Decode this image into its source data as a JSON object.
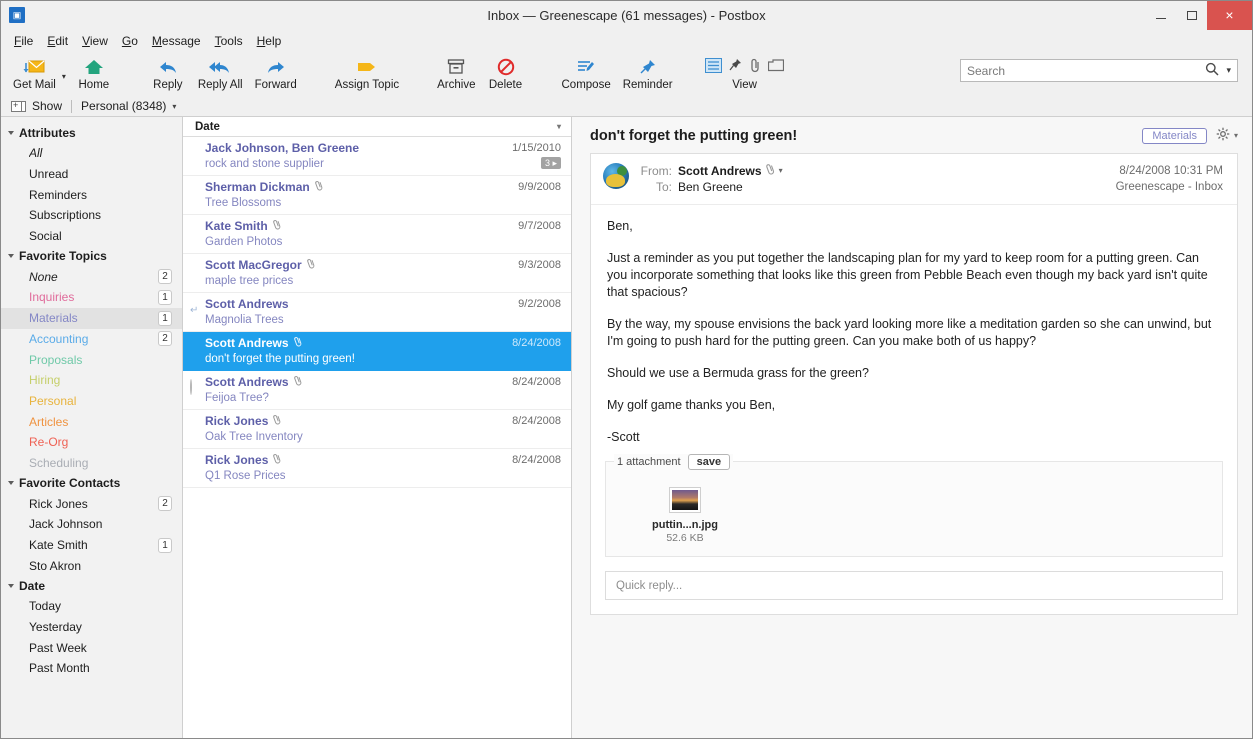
{
  "window": {
    "title": "Inbox — Greenescape (61 messages) - Postbox",
    "app_icon": "postbox-icon",
    "minimize": "–",
    "maximize": "□",
    "close": "×"
  },
  "menubar": [
    {
      "label": "File",
      "accel": "F"
    },
    {
      "label": "Edit",
      "accel": "E"
    },
    {
      "label": "View",
      "accel": "V"
    },
    {
      "label": "Go",
      "accel": "G"
    },
    {
      "label": "Message",
      "accel": "M"
    },
    {
      "label": "Tools",
      "accel": "T"
    },
    {
      "label": "Help",
      "accel": "H"
    }
  ],
  "toolbar": {
    "buttons": [
      {
        "label": "Get Mail",
        "icon": "get-mail-icon"
      },
      {
        "label": "Home",
        "icon": "home-icon"
      },
      {
        "label": "Reply",
        "icon": "reply-icon"
      },
      {
        "label": "Reply All",
        "icon": "reply-all-icon"
      },
      {
        "label": "Forward",
        "icon": "forward-icon"
      },
      {
        "label": "Assign Topic",
        "icon": "tag-icon"
      },
      {
        "label": "Archive",
        "icon": "archive-icon"
      },
      {
        "label": "Delete",
        "icon": "delete-icon"
      },
      {
        "label": "Compose",
        "icon": "compose-icon"
      },
      {
        "label": "Reminder",
        "icon": "reminder-pin-icon"
      }
    ],
    "view_group": {
      "label": "View",
      "icons": [
        "layout-icon",
        "pin-icon",
        "attachment-icon",
        "window-icon"
      ]
    },
    "dropdown_caret": "▾"
  },
  "search": {
    "placeholder": "Search",
    "value": "",
    "icon": "search-icon",
    "caret": "▾"
  },
  "showbar": {
    "show_label": "Show",
    "account_label": "Personal (8348)",
    "caret": "▾"
  },
  "sidebar": {
    "groups": [
      {
        "title": "Attributes",
        "items": [
          {
            "label": "All",
            "count": "",
            "style": "italic",
            "color": "#1d1d1d"
          },
          {
            "label": "Unread",
            "count": "",
            "color": "#1d1d1d"
          },
          {
            "label": "Reminders",
            "count": "",
            "color": "#1d1d1d"
          },
          {
            "label": "Subscriptions",
            "count": "",
            "color": "#1d1d1d"
          },
          {
            "label": "Social",
            "count": "",
            "color": "#1d1d1d"
          }
        ]
      },
      {
        "title": "Favorite Topics",
        "items": [
          {
            "label": "None",
            "count": "2",
            "style": "italic",
            "color": "#1d1d1d"
          },
          {
            "label": "Inquiries",
            "count": "1",
            "color": "#e06b9b"
          },
          {
            "label": "Materials",
            "count": "1",
            "color": "#8487c6",
            "selected": true
          },
          {
            "label": "Accounting",
            "count": "2",
            "color": "#5aabe8"
          },
          {
            "label": "Proposals",
            "count": "",
            "color": "#6fc9a8"
          },
          {
            "label": "Hiring",
            "count": "",
            "color": "#c5cf6a"
          },
          {
            "label": "Personal",
            "count": "",
            "color": "#e8b33c"
          },
          {
            "label": "Articles",
            "count": "",
            "color": "#ef9340"
          },
          {
            "label": "Re-Org",
            "count": "",
            "color": "#ef6154"
          },
          {
            "label": "Scheduling",
            "count": "",
            "color": "#a9adb4"
          }
        ]
      },
      {
        "title": "Favorite Contacts",
        "items": [
          {
            "label": "Rick Jones",
            "count": "2",
            "color": "#1d1d1d"
          },
          {
            "label": "Jack Johnson",
            "count": "",
            "color": "#1d1d1d"
          },
          {
            "label": "Kate Smith",
            "count": "1",
            "color": "#1d1d1d"
          },
          {
            "label": "Sto Akron",
            "count": "",
            "color": "#1d1d1d"
          }
        ]
      },
      {
        "title": "Date",
        "items": [
          {
            "label": "Today",
            "count": "",
            "color": "#1d1d1d"
          },
          {
            "label": "Yesterday",
            "count": "",
            "color": "#1d1d1d"
          },
          {
            "label": "Past Week",
            "count": "",
            "color": "#1d1d1d"
          },
          {
            "label": "Past Month",
            "count": "",
            "color": "#1d1d1d"
          }
        ]
      }
    ]
  },
  "messagelist": {
    "column_header": "Date",
    "sort_caret": "▾",
    "rows": [
      {
        "from": "Jack Johnson, Ben Greene",
        "subject": "rock and stone supplier",
        "date": "1/15/2010",
        "attachment": false,
        "status": "none",
        "thread_badge": "3",
        "selected": false
      },
      {
        "from": "Sherman Dickman",
        "subject": "Tree Blossoms",
        "date": "9/9/2008",
        "attachment": true,
        "status": "none",
        "thread_badge": "",
        "selected": false
      },
      {
        "from": "Kate Smith",
        "subject": "Garden Photos",
        "date": "9/7/2008",
        "attachment": true,
        "status": "unread",
        "thread_badge": "",
        "selected": false
      },
      {
        "from": "Scott MacGregor",
        "subject": "maple tree prices",
        "date": "9/3/2008",
        "attachment": true,
        "status": "none",
        "thread_badge": "",
        "selected": false
      },
      {
        "from": "Scott Andrews",
        "subject": "Magnolia Trees",
        "date": "9/2/2008",
        "attachment": false,
        "status": "replied",
        "thread_badge": "",
        "selected": false
      },
      {
        "from": "Scott Andrews",
        "subject": "don't forget the putting green!",
        "date": "8/24/2008",
        "attachment": true,
        "status": "none",
        "thread_badge": "",
        "selected": true
      },
      {
        "from": "Scott Andrews",
        "subject": "Feijoa Tree?",
        "date": "8/24/2008",
        "attachment": true,
        "status": "ring",
        "thread_badge": "",
        "selected": false
      },
      {
        "from": "Rick Jones",
        "subject": "Oak Tree Inventory",
        "date": "8/24/2008",
        "attachment": true,
        "status": "none",
        "thread_badge": "",
        "selected": false
      },
      {
        "from": "Rick Jones",
        "subject": "Q1 Rose Prices",
        "date": "8/24/2008",
        "attachment": true,
        "status": "none",
        "thread_badge": "",
        "selected": false
      }
    ]
  },
  "reader": {
    "subject": "don't forget the putting green!",
    "topic_tag": "Materials",
    "gear_icon": "gear-icon",
    "gear_caret": "▾",
    "from_label": "From:",
    "from_value": "Scott Andrews",
    "from_caret": "▾",
    "to_label": "To:",
    "to_value": "Ben Greene",
    "timestamp": "8/24/2008 10:31 PM",
    "folder": "Greenescape - Inbox",
    "paragraphs": [
      "Ben,",
      "Just a reminder as you put together the landscaping plan for my yard to keep room for a putting green. Can you incorporate something that looks like this green from Pebble Beach even though my back yard isn't quite that spacious?",
      "By the way, my spouse envisions the back yard looking more like a meditation garden so she can unwind, but I'm going to push hard for the putting green. Can you make both of us happy?",
      "Should we use a Bermuda grass for the green?",
      "My golf game thanks you Ben,",
      "-Scott"
    ],
    "attachments": {
      "count_label": "1 attachment",
      "save_label": "save",
      "files": [
        {
          "name": "puttin...n.jpg",
          "size": "52.6 KB"
        }
      ]
    },
    "quick_reply_placeholder": "Quick reply..."
  },
  "colors": {
    "selection_blue": "#1fa0ec",
    "sender_purple": "#5d5fa8",
    "subject_purple": "#8486c0",
    "close_red": "#d9534f"
  }
}
